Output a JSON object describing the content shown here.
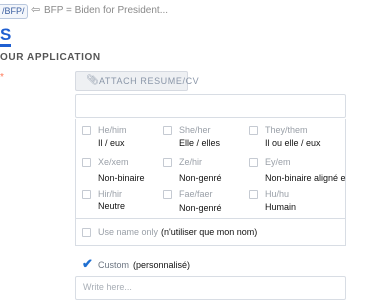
{
  "header": {
    "tag": "/BFP/",
    "breadcrumb": "BFP = Biden for President..."
  },
  "logo": {
    "text": "S"
  },
  "section": {
    "title": "OUR APPLICATION",
    "required_mark": "*"
  },
  "attach": {
    "label": "ATTACH RESUME/CV",
    "icon": "paperclip-icon"
  },
  "pronouns": {
    "options": [
      {
        "label": "He/him",
        "translation": "Il / eux"
      },
      {
        "label": "She/her",
        "translation": "Elle / elles"
      },
      {
        "label": "They/them",
        "translation": "Il ou elle / eux"
      },
      {
        "label": "Xe/xem",
        "translation": "Non-binaire"
      },
      {
        "label": "Ze/hir",
        "translation": "Non-genré"
      },
      {
        "label": "Ey/em",
        "translation": "Non-binaire aligné e"
      },
      {
        "label": "Hir/hir",
        "translation": "Neutre"
      },
      {
        "label": "Fae/faer",
        "translation": "Non-genré"
      },
      {
        "label": "Hu/hu",
        "translation": "Humain"
      }
    ],
    "use_name_only": {
      "label": "Use name only",
      "translation": "(n'utiliser que mon nom)"
    },
    "custom": {
      "label": "Custom",
      "translation": "(personnalisé)",
      "checked": true
    },
    "custom_input_placeholder": "Write here..."
  },
  "colors": {
    "accent": "#1f5fd1",
    "required": "#ff7a59"
  }
}
